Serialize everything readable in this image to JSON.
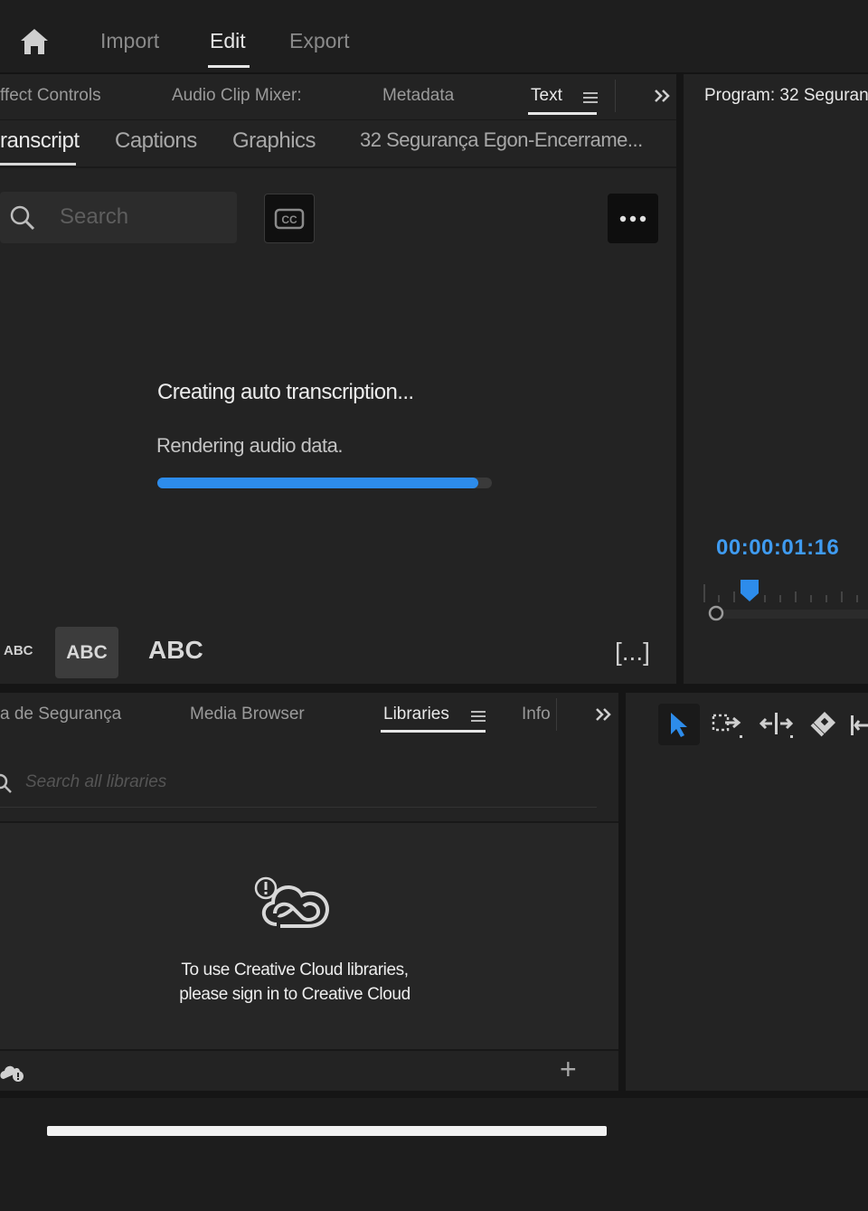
{
  "topnav": {
    "import": "Import",
    "edit": "Edit",
    "export": "Export"
  },
  "upper_tabs": [
    {
      "label": "ffect Controls"
    },
    {
      "label": "Audio Clip Mixer:"
    },
    {
      "label": "Metadata"
    },
    {
      "label": "Text"
    }
  ],
  "sub_tabs": [
    {
      "label": "ranscript"
    },
    {
      "label": "Captions"
    },
    {
      "label": "Graphics"
    },
    {
      "label": "32 Segurança Egon-Encerrame..."
    }
  ],
  "transcript": {
    "search_placeholder": "Search",
    "status_title": "Creating auto transcription...",
    "status_sub": "Rendering audio data.",
    "progress": 0.96,
    "text_size_small": "ABC",
    "text_size_medium": "ABC",
    "text_size_large": "ABC",
    "bracket_label": "[...]"
  },
  "program": {
    "title": "Program: 32 Seguran",
    "timecode": "00:00:01:16"
  },
  "lower_tabs": [
    {
      "label": "a de Segurança"
    },
    {
      "label": "Media Browser"
    },
    {
      "label": "Libraries"
    },
    {
      "label": "Info"
    }
  ],
  "libraries": {
    "search_placeholder": "Search all libraries",
    "message_line1": "To use Creative Cloud libraries,",
    "message_line2": "please sign in to Creative Cloud",
    "add_label": "+"
  },
  "colors": {
    "accent": "#2d8ceb",
    "timecode": "#3f9bf0"
  },
  "icons": [
    "home-icon",
    "menu-icon",
    "chevron-double-right-icon",
    "search-icon",
    "closed-captions-icon",
    "more-icon",
    "selection-tool-icon",
    "track-select-forward-icon",
    "ripple-edit-icon",
    "razor-icon",
    "slip-icon",
    "creative-cloud-icon",
    "cloud-sync-icon"
  ]
}
